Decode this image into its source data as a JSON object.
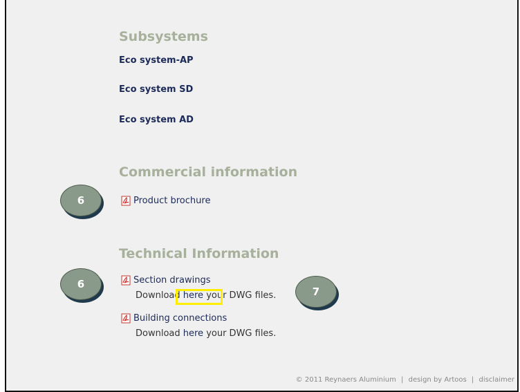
{
  "subsystems": {
    "heading": "Subsystems",
    "items": [
      "Eco system-AP",
      "Eco system SD",
      "Eco system AD"
    ]
  },
  "commercial": {
    "heading": "Commercial information",
    "brochure_label": "Product brochure"
  },
  "technical": {
    "heading": "Technical Information",
    "section_drawings_label": "Section drawings",
    "building_connections_label": "Building connections",
    "download_prefix": "Download ",
    "download_link": "here",
    "download_suffix": " your DWG files."
  },
  "callouts": [
    "6",
    "6",
    "7"
  ],
  "footer": {
    "copyright": "© 2011 Reynaers Aluminium",
    "sep": "|",
    "design": "design by Artoos",
    "disclaimer": "disclaimer"
  },
  "colors": {
    "heading": "#a7b09b",
    "link": "#1c2a5a",
    "background": "#f0f0f0",
    "callout_fill": "#8a9a8a",
    "highlight": "#ffee00"
  },
  "icons": [
    "pdf-icon"
  ]
}
